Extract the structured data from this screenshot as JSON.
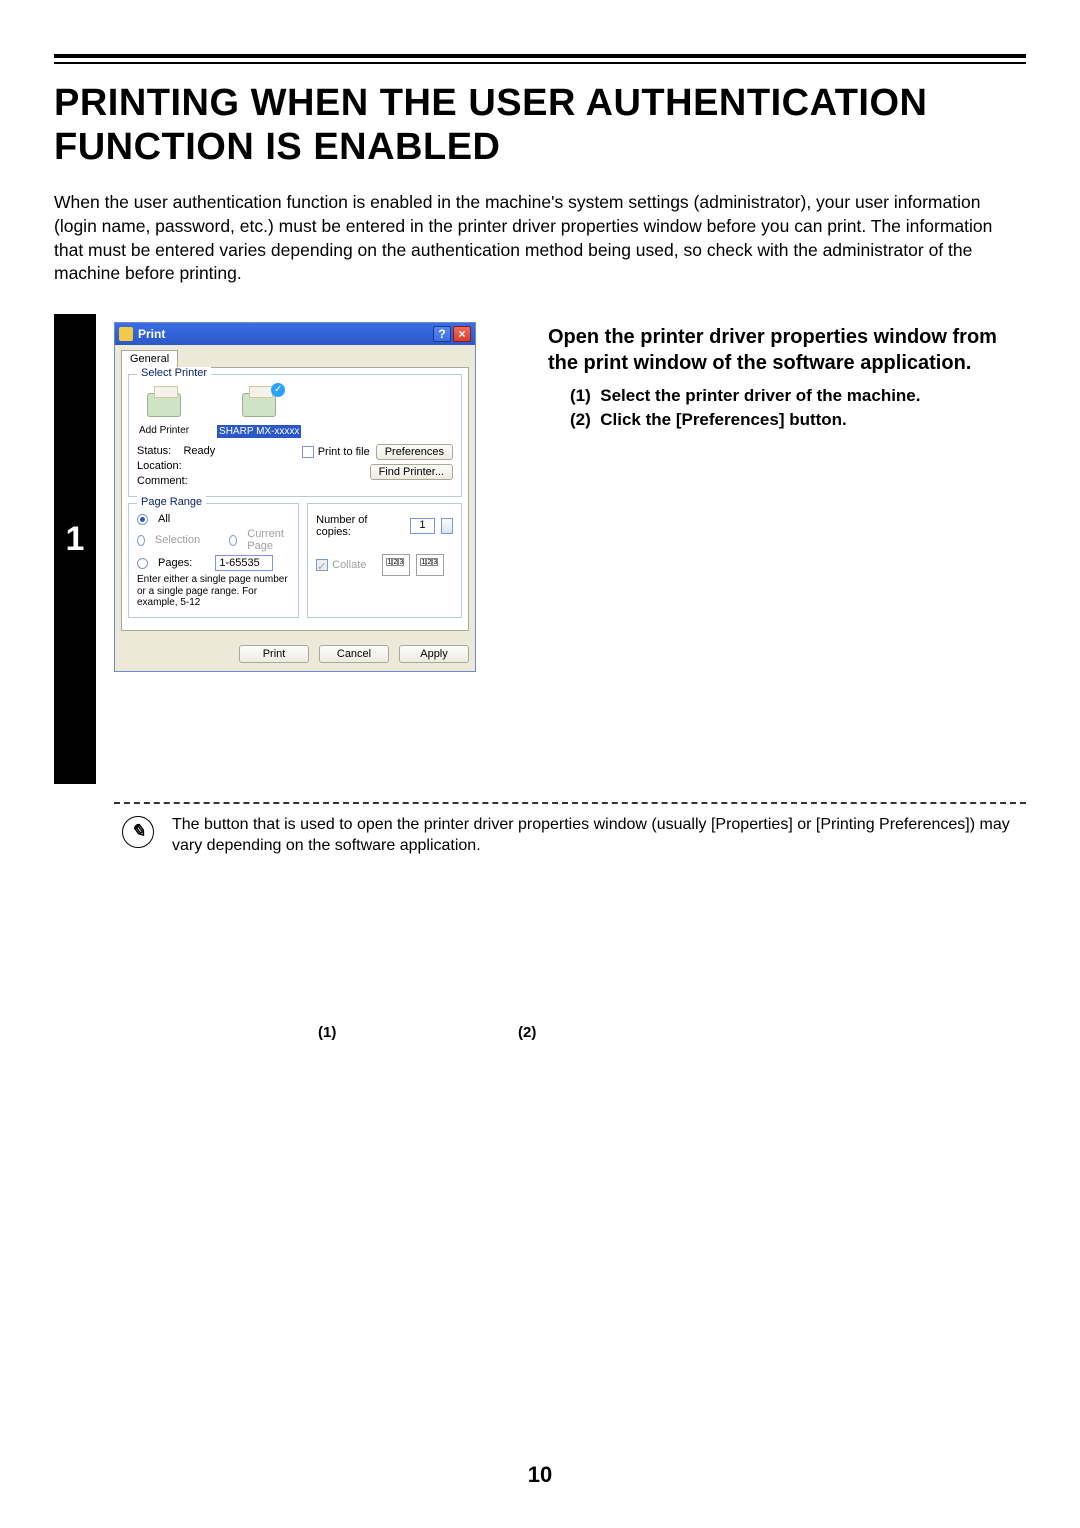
{
  "title": "PRINTING WHEN THE USER AUTHENTICATION FUNCTION IS ENABLED",
  "intro": "When the user authentication function is enabled in the machine's system settings (administrator), your user information (login name, password, etc.) must be entered in the printer driver properties window before you can print. The information that must be entered varies depending on the authentication method being used, so check with the administrator of the machine before printing.",
  "step": {
    "number": "1",
    "heading": "Open the printer driver properties window from the print window of the software application.",
    "items": [
      {
        "num": "(1)",
        "text": "Select the printer driver of the machine."
      },
      {
        "num": "(2)",
        "text": "Click the [Preferences] button."
      }
    ]
  },
  "dialog": {
    "title": "Print",
    "tabs": [
      "General"
    ],
    "groups": {
      "select_printer": "Select Printer",
      "page_range": "Page Range"
    },
    "printers": {
      "add": "Add Printer",
      "sharp": "SHARP\nMX-xxxxx"
    },
    "status": {
      "status_lbl": "Status:",
      "status_val": "Ready",
      "location_lbl": "Location:",
      "comment_lbl": "Comment:",
      "print_to_file": "Print to file",
      "preferences": "Preferences",
      "find_printer": "Find Printer..."
    },
    "page_range": {
      "all": "All",
      "selection": "Selection",
      "current": "Current Page",
      "pages": "Pages:",
      "pages_val": "1-65535",
      "note": "Enter either a single page number or a single page range.  For example, 5-12"
    },
    "copies": {
      "label": "Number of copies:",
      "value": "1",
      "collate": "Collate"
    },
    "buttons": {
      "print": "Print",
      "cancel": "Cancel",
      "apply": "Apply"
    }
  },
  "callouts": {
    "c1": "(1)",
    "c2": "(2)"
  },
  "note": "The button that is used to open the printer driver properties window (usually [Properties] or [Printing Preferences]) may vary depending on the software application.",
  "page_number": "10"
}
